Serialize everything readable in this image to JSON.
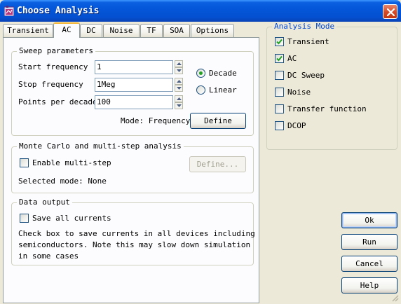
{
  "window": {
    "title": "Choose Analysis"
  },
  "tabs": [
    {
      "label": "Transient"
    },
    {
      "label": "AC"
    },
    {
      "label": "DC"
    },
    {
      "label": "Noise"
    },
    {
      "label": "TF"
    },
    {
      "label": "SOA"
    },
    {
      "label": "Options"
    }
  ],
  "sweep": {
    "title": "Sweep parameters",
    "start_label": "Start frequency",
    "start_value": "1",
    "stop_label": "Stop frequency",
    "stop_value": "1Meg",
    "points_label": "Points per decade",
    "points_value": "100",
    "decade_label": "Decade",
    "linear_label": "Linear",
    "selected_scale": "Decade",
    "mode_text": "Mode: Frequency",
    "define_label": "Define"
  },
  "montecarlo": {
    "title": "Monte Carlo and multi-step analysis",
    "enable_label": "Enable multi-step",
    "enable_checked": false,
    "define_label": "Define...",
    "selected_mode_text": "Selected mode: None"
  },
  "data_output": {
    "title": "Data output",
    "save_label": "Save all currents",
    "save_checked": false,
    "note_line1": "Check box to save currents in all devices including",
    "note_line2": "semiconductors. Note this may slow down simulation",
    "note_line3": "in some cases"
  },
  "analysis_mode": {
    "title": "Analysis Mode",
    "items": [
      {
        "label": "Transient",
        "checked": true
      },
      {
        "label": "AC",
        "checked": true
      },
      {
        "label": "DC Sweep",
        "checked": false
      },
      {
        "label": "Noise",
        "checked": false
      },
      {
        "label": "Transfer function",
        "checked": false
      },
      {
        "label": "DCOP",
        "checked": false
      }
    ]
  },
  "buttons": {
    "ok": "Ok",
    "run": "Run",
    "cancel": "Cancel",
    "help": "Help"
  },
  "colors": {
    "titlebar": "#0556d9",
    "dialog_bg": "#ece9d8",
    "active_tab_accent": "#f3b533",
    "group_title_accent": "#0046d5",
    "check_green": "#21a121"
  }
}
